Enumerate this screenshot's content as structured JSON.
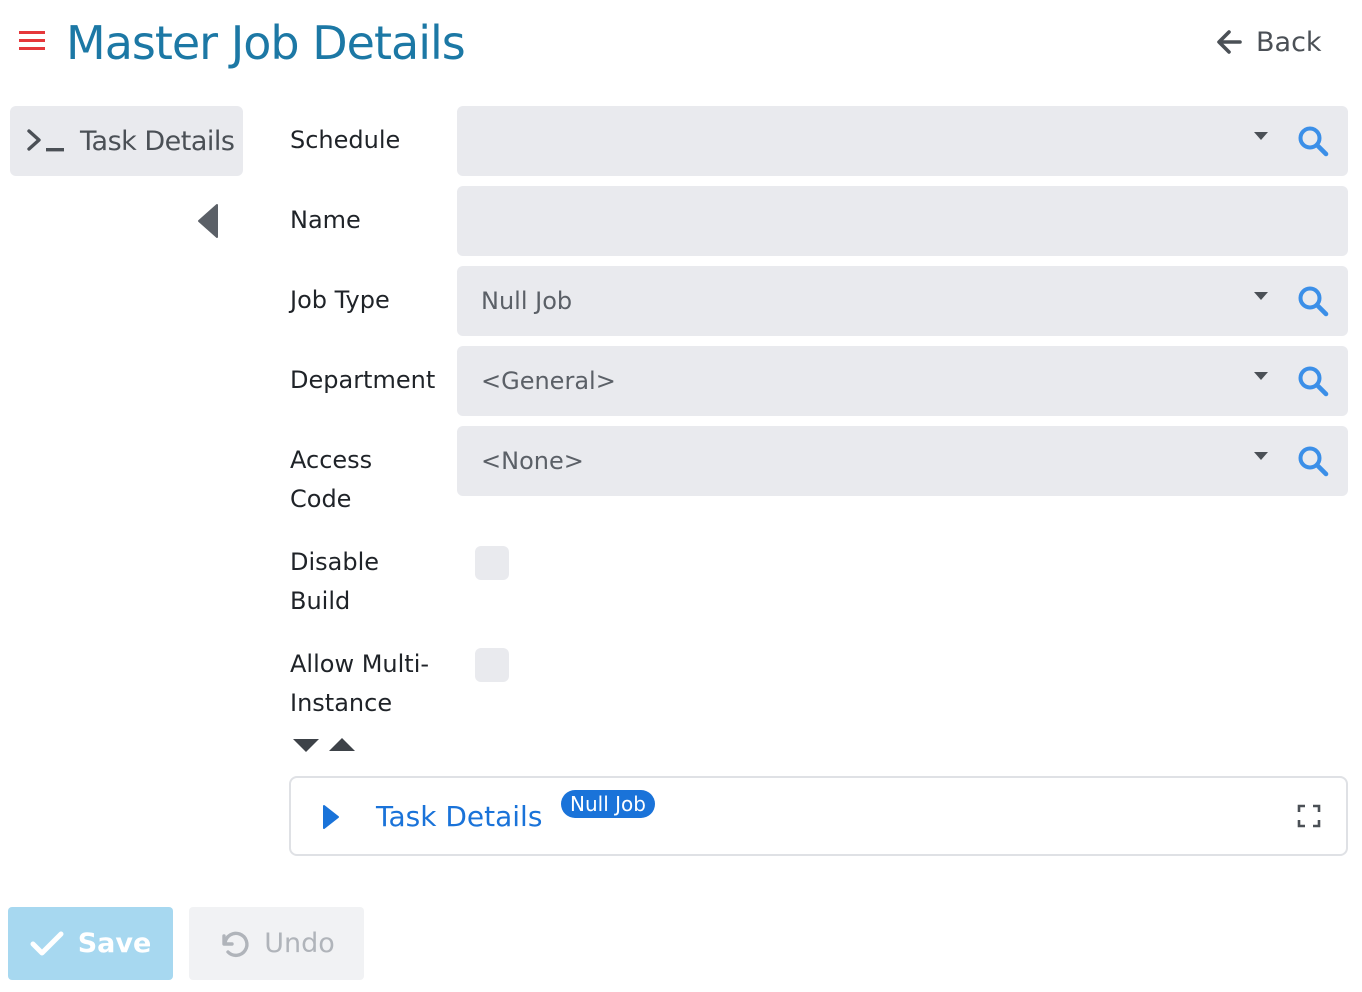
{
  "header": {
    "title": "Master Job Details",
    "back_label": "Back"
  },
  "sidebar": {
    "tab_label": "Task Details"
  },
  "form": {
    "schedule": {
      "label": "Schedule",
      "value": ""
    },
    "name": {
      "label": "Name",
      "value": ""
    },
    "job_type": {
      "label": "Job Type",
      "value": "Null Job"
    },
    "department": {
      "label": "Department",
      "value": "<General>"
    },
    "access_code": {
      "label_line1": "Access",
      "label_line2": "Code",
      "value": "<None>"
    },
    "disable_build": {
      "label_line1": "Disable",
      "label_line2": "Build",
      "checked": false
    },
    "allow_multi_instance": {
      "label_line1": "Allow Multi-",
      "label_line2": "Instance",
      "checked": false
    }
  },
  "task_panel": {
    "title": "Task Details",
    "badge": "Null Job"
  },
  "actions": {
    "save_label": "Save",
    "undo_label": "Undo"
  },
  "colors": {
    "title_blue": "#1c78a5",
    "menu_red": "#e5383b",
    "link_blue": "#1a73d9",
    "search_blue": "#3b8fe8",
    "field_bg": "#e9eaee",
    "save_bg": "#a7d8f0"
  },
  "icons": {
    "menu": "hamburger-icon",
    "back": "arrow-left-icon",
    "terminal": "terminal-icon",
    "collapse": "caret-left-icon",
    "search": "search-icon",
    "dropdown": "caret-down-icon",
    "expand": "caret-down-icon",
    "collapse_all": "caret-up-icon",
    "panel_toggle": "caret-right-icon",
    "fullscreen": "expand-icon",
    "save": "check-icon",
    "undo": "undo-icon"
  }
}
